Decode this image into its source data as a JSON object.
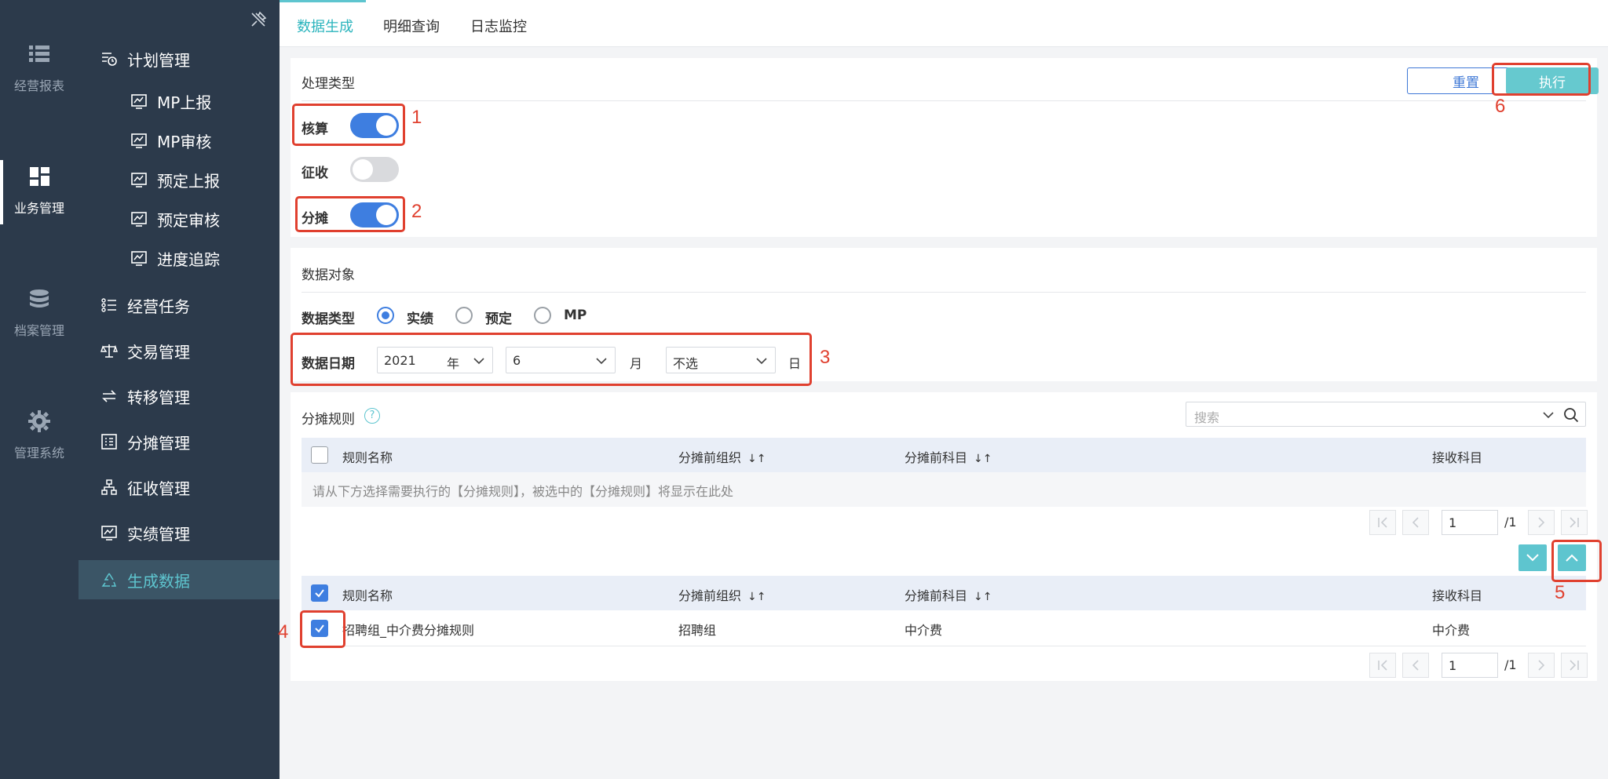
{
  "rail": {
    "items": [
      {
        "label": "经营报表",
        "icon": "list-icon"
      },
      {
        "label": "业务管理",
        "icon": "dashboard-icon"
      },
      {
        "label": "档案管理",
        "icon": "database-icon"
      },
      {
        "label": "管理系统",
        "icon": "gear-icon"
      }
    ]
  },
  "subnav": {
    "items": [
      {
        "label": "计划管理",
        "icon": "plan-icon"
      },
      {
        "label": "MP上报",
        "icon": "report-icon"
      },
      {
        "label": "MP审核",
        "icon": "audit-icon"
      },
      {
        "label": "预定上报",
        "icon": "report-icon"
      },
      {
        "label": "预定审核",
        "icon": "audit-icon"
      },
      {
        "label": "进度追踪",
        "icon": "track-icon"
      },
      {
        "label": "经营任务",
        "icon": "task-icon"
      },
      {
        "label": "交易管理",
        "icon": "scale-icon"
      },
      {
        "label": "转移管理",
        "icon": "transfer-icon"
      },
      {
        "label": "分摊管理",
        "icon": "allocate-icon"
      },
      {
        "label": "征收管理",
        "icon": "org-icon"
      },
      {
        "label": "实绩管理",
        "icon": "chart-icon"
      },
      {
        "label": "生成数据",
        "icon": "recycle-icon"
      }
    ]
  },
  "tabs": [
    {
      "label": "数据生成"
    },
    {
      "label": "明细查询"
    },
    {
      "label": "日志监控"
    }
  ],
  "process": {
    "title": "处理类型",
    "reset_label": "重置",
    "exec_label": "执行",
    "switches": [
      {
        "label": "核算",
        "on": true
      },
      {
        "label": "征收",
        "on": false
      },
      {
        "label": "分摊",
        "on": true
      }
    ]
  },
  "data_object": {
    "title": "数据对象",
    "type_label": "数据类型",
    "types": [
      {
        "label": "实绩",
        "selected": true
      },
      {
        "label": "预定",
        "selected": false
      },
      {
        "label": "MP",
        "selected": false
      }
    ],
    "date_label": "数据日期",
    "year": {
      "value": "2021",
      "unit": "年"
    },
    "month": {
      "value": "6",
      "unit": "月"
    },
    "day": {
      "value": "不选",
      "unit": "日"
    }
  },
  "rules": {
    "title": "分摊规则",
    "help": "?",
    "search_placeholder": "搜索",
    "columns": [
      "规则名称",
      "分摊前组织",
      "分摊前科目",
      "接收科目"
    ],
    "sort_icon": "↓↑",
    "empty_message": "请从下方选择需要执行的【分摊规则】，被选中的【分摊规则】将显示在此处",
    "top_pager": {
      "page": "1",
      "total": "/1"
    },
    "bottom_rows": [
      {
        "name": "招聘组_中介费分摊规则",
        "org": "招聘组",
        "subject": "中介费",
        "receive": "中介费",
        "checked": true
      }
    ],
    "bottom_pager": {
      "page": "1",
      "total": "/1"
    }
  },
  "annotations": [
    "1",
    "2",
    "3",
    "4",
    "5",
    "6"
  ],
  "colors": {
    "sidebar": "#2c3a4b",
    "accent": "#5ec5cf",
    "primary": "#3e7ee0",
    "annotation": "#e0402f"
  }
}
